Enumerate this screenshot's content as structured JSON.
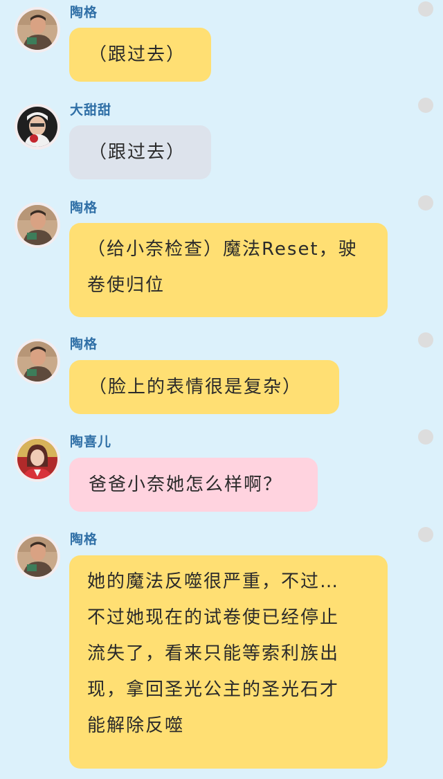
{
  "messages": [
    {
      "sender": "陶格",
      "text": "（跟过去）",
      "bubble_color": "#ffdf73",
      "avatar": "tao-ge-avatar"
    },
    {
      "sender": "大甜甜",
      "text": "（跟过去）",
      "bubble_color": "#dde3ec",
      "avatar": "da-tian-tian-avatar"
    },
    {
      "sender": "陶格",
      "text": "（给小奈检查）魔法Reset，驶卷使归位",
      "bubble_color": "#ffdf73",
      "avatar": "tao-ge-avatar"
    },
    {
      "sender": "陶格",
      "text": "（脸上的表情很是复杂）",
      "bubble_color": "#ffdf73",
      "avatar": "tao-ge-avatar"
    },
    {
      "sender": "陶喜儿",
      "text": "爸爸小奈她怎么样啊？",
      "bubble_color": "#ffd3df",
      "avatar": "tao-xi-er-avatar"
    },
    {
      "sender": "陶格",
      "text": "她的魔法反噬很严重，不过…不过她现在的试卷使已经停止流失了，看来只能等索利族出现，拿回圣光公主的圣光石才能解除反噬",
      "bubble_color": "#ffdf73",
      "avatar": "tao-ge-avatar"
    }
  ],
  "lines": {
    "m3": [
      "（给小奈检查）魔法Reset，驶",
      "卷使归位"
    ],
    "m6": [
      "她的魔法反噬很严重，不过…",
      "不过她现在的试卷使已经停止",
      "流失了，看来只能等索利族出",
      "现，拿回圣光公主的圣光石才",
      "能解除反噬"
    ]
  }
}
